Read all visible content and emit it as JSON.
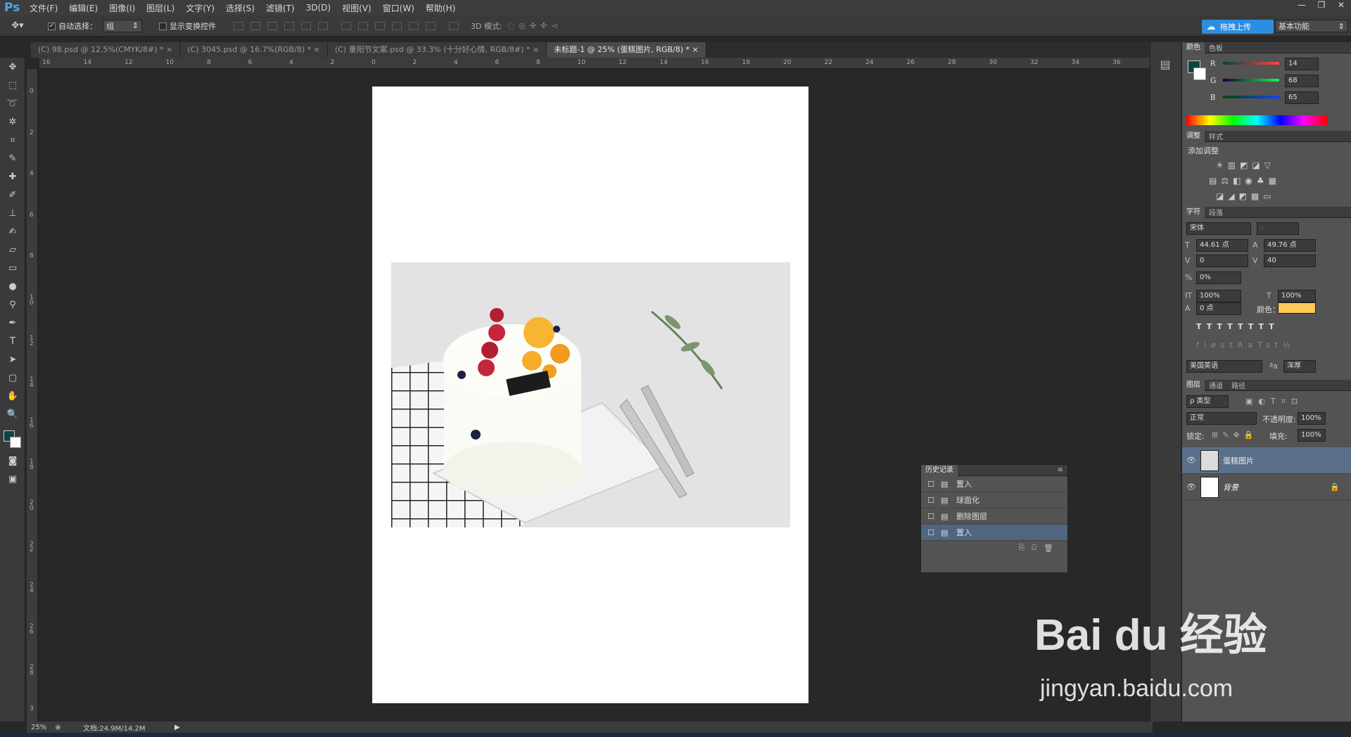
{
  "app": {
    "logo": "Ps"
  },
  "menu": [
    "文件(F)",
    "编辑(E)",
    "图像(I)",
    "图层(L)",
    "文字(Y)",
    "选择(S)",
    "滤镜(T)",
    "3D(D)",
    "视图(V)",
    "窗口(W)",
    "帮助(H)"
  ],
  "window_controls": {
    "min": "—",
    "restore": "❐",
    "close": "✕"
  },
  "options": {
    "auto_select_label": "自动选择：",
    "auto_select_value": "组",
    "show_transform_label": "显示变换控件",
    "mode_3d": "3D 模式:",
    "upload_label": "拖拽上传",
    "workspace": "基本功能"
  },
  "tabs": [
    "(C) 98.psd @ 12.5%(CMYK/8#) *",
    "(C) 3045.psd @ 16.7%(RGB/8) *",
    "(C) 重阳节文案.psd @ 33.3% (十分好心情, RGB/8#) *",
    "未标题-1 @ 25% (蛋糕图片, RGB/8) *"
  ],
  "ruler_h": [
    "16",
    "14",
    "12",
    "10",
    "8",
    "6",
    "4",
    "2",
    "0",
    "2",
    "4",
    "6",
    "8",
    "10",
    "12",
    "14",
    "16",
    "18",
    "20",
    "22",
    "24",
    "26",
    "28",
    "30",
    "32",
    "34",
    "36"
  ],
  "ruler_v": [
    "0",
    "2",
    "4",
    "6",
    "8",
    "1\n0",
    "1\n2",
    "1\n4",
    "1\n6",
    "1\n8",
    "2\n0",
    "2\n2",
    "2\n4",
    "2\n6",
    "2\n8",
    "3"
  ],
  "color_panel": {
    "tabs": [
      "颜色",
      "色板"
    ],
    "r_label": "R",
    "g_label": "G",
    "b_label": "B",
    "r": "14",
    "g": "68",
    "b": "65",
    "fg": "#0e4441"
  },
  "adjust_panel": {
    "tabs": [
      "调整",
      "样式"
    ],
    "title": "添加调整"
  },
  "char_panel": {
    "tabs": [
      "字符",
      "段落"
    ],
    "font": "宋体",
    "style": "-",
    "size": "44.61 点",
    "leading": "49.76 点",
    "kerning": "0",
    "tracking": "40",
    "scale_pct": "0%",
    "vscale": "100%",
    "hscale": "100%",
    "baseline": "0 点",
    "color_label": "颜色：",
    "color": "#fdc75a",
    "lang": "美国英语",
    "aa_label": "ªa",
    "aa": "浑厚"
  },
  "layers_panel": {
    "tabs": [
      "图层",
      "通道",
      "路径"
    ],
    "filter": "ρ 类型",
    "blend": "正常",
    "opacity_label": "不透明度:",
    "opacity": "100%",
    "lock_label": "锁定:",
    "fill_label": "填充:",
    "fill": "100%",
    "layers": [
      {
        "name": "蛋糕图片"
      },
      {
        "name": "背景"
      }
    ]
  },
  "history_panel": {
    "title": "历史记录",
    "items": [
      "置入",
      "球面化",
      "删除图层",
      "置入"
    ]
  },
  "status": {
    "zoom": "25%",
    "doc": "文档:24.9M/14.2M"
  },
  "watermark": {
    "brand": "Bai du 经验",
    "url": "jingyan.baidu.com"
  }
}
